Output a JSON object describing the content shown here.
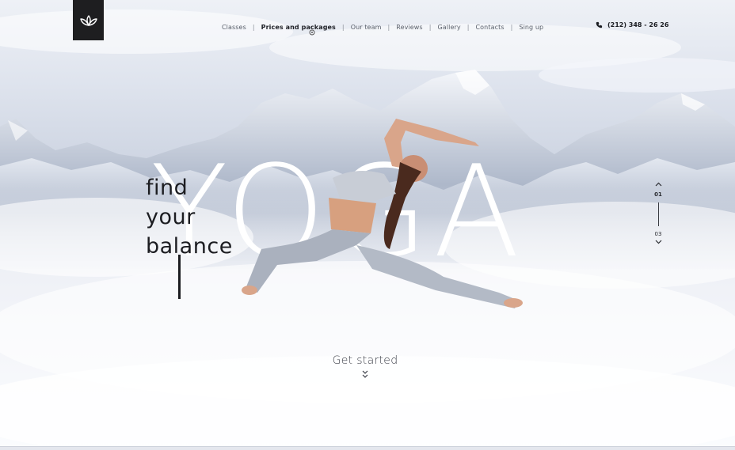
{
  "brand": {
    "logo_icon": "lotus-icon"
  },
  "nav": {
    "items": [
      {
        "label": "Classes",
        "active": false
      },
      {
        "label": "Prices and packages",
        "active": true
      },
      {
        "label": "Our team",
        "active": false
      },
      {
        "label": "Reviews",
        "active": false
      },
      {
        "label": "Gallery",
        "active": false
      },
      {
        "label": "Contacts",
        "active": false
      },
      {
        "label": "Sing up",
        "active": false
      }
    ],
    "separator": "|"
  },
  "contact": {
    "phone": "(212) 348 - 26 26",
    "icon": "phone-icon"
  },
  "hero": {
    "line1": "find",
    "line2": "your",
    "line3": "balance",
    "big_word": "YOGA",
    "cta": "Get started"
  },
  "slider": {
    "current": "01",
    "total": "03"
  },
  "colors": {
    "accent": "#1c1d21",
    "logo_bg": "#1e1e20",
    "sky": "#dfe4ee"
  }
}
